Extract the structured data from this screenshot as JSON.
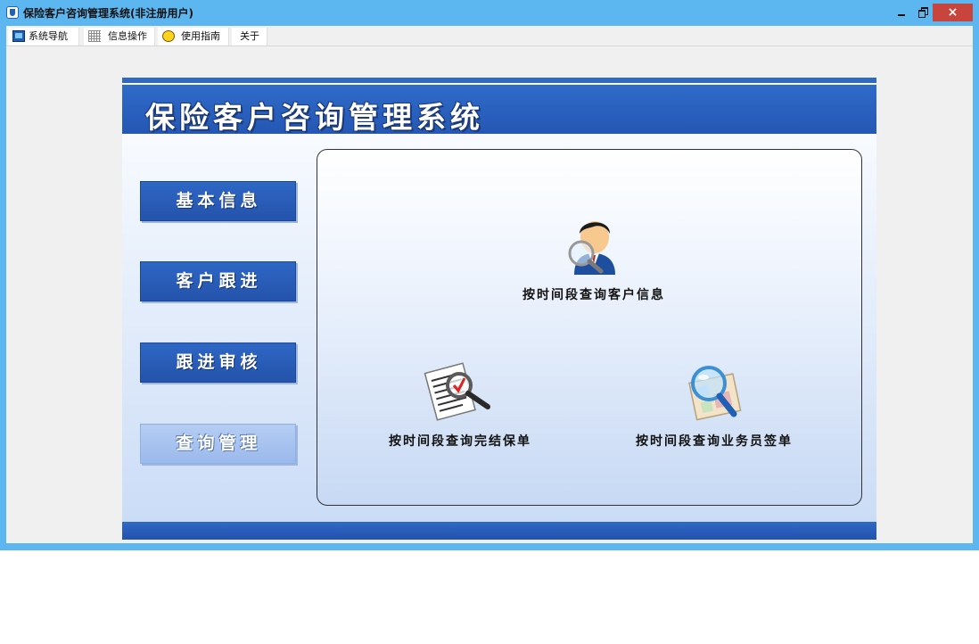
{
  "window": {
    "title": "保险客户咨询管理系统(非注册用户)",
    "controls": {
      "minimize": "minimize",
      "restore": "restore",
      "close": "×"
    }
  },
  "menu": [
    {
      "label": "系统导航",
      "icon": "monitor-icon"
    },
    {
      "label": "信息操作",
      "icon": "grid-icon"
    },
    {
      "label": "使用指南",
      "icon": "bulb-icon"
    },
    {
      "label": "关于"
    }
  ],
  "banner": {
    "title": "保险客户咨询管理系统"
  },
  "nav": [
    {
      "label": "基本信息"
    },
    {
      "label": "客户跟进"
    },
    {
      "label": "跟进审核"
    },
    {
      "label": "查询管理",
      "selected": true
    }
  ],
  "functions": [
    {
      "label": "按时间段查询客户信息",
      "icon": "user-search-icon"
    },
    {
      "label": "按时间段查询完结保单",
      "icon": "document-search-icon"
    },
    {
      "label": "按时间段查询业务员签单",
      "icon": "map-search-icon"
    }
  ],
  "colors": {
    "titlebar": "#5cb6ef",
    "banner": "#2557b4",
    "nav_button": "#2e67c5",
    "nav_selected": "#a8c4f0",
    "close_button": "#c8453d"
  }
}
